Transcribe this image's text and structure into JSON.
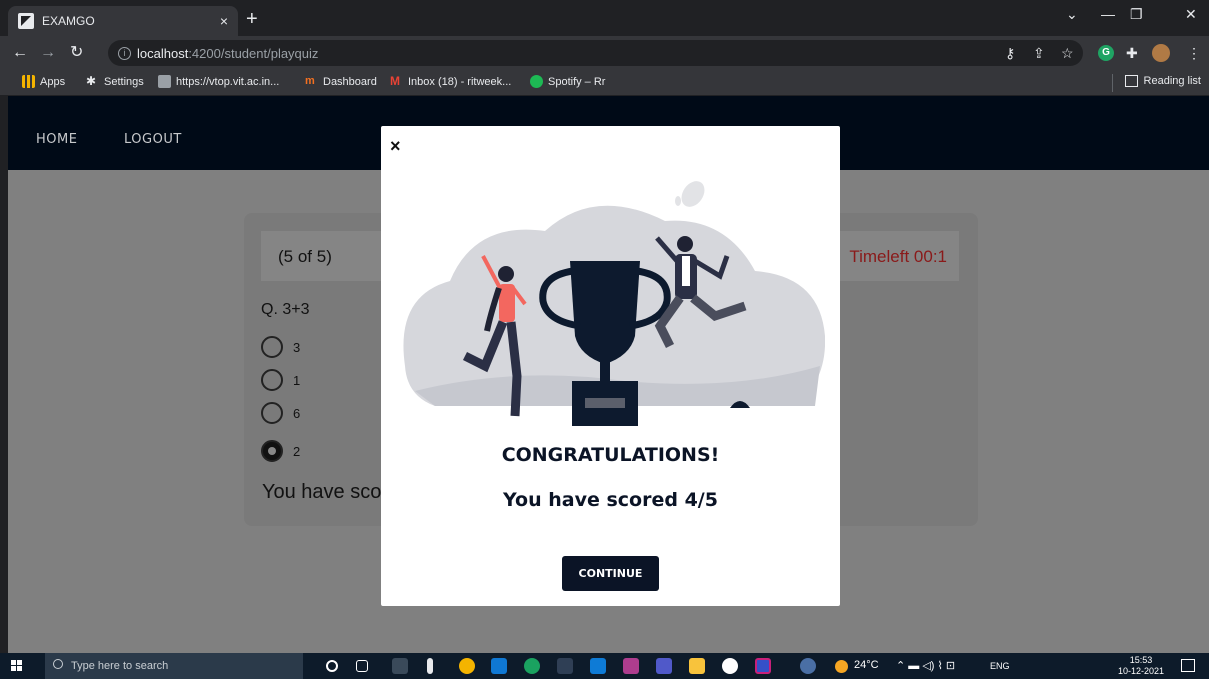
{
  "browser": {
    "tab_title": "EXAMGO",
    "tab_close": "×",
    "new_tab": "+",
    "url_host": "localhost",
    "url_path": ":4200/student/playquiz",
    "bookmarks": [
      {
        "label": "Apps",
        "icon": "apps-grid-icon",
        "color": "#f4b400"
      },
      {
        "label": "Settings",
        "icon": "gear-icon",
        "color": "#e8eaed"
      },
      {
        "label": "https://vtop.vit.ac.in...",
        "icon": "vtop-icon",
        "color": "#9aa0a6"
      },
      {
        "label": "Dashboard",
        "icon": "dashboard-icon",
        "color": "#f37021"
      },
      {
        "label": "Inbox (18) - ritweek...",
        "icon": "gmail-icon",
        "color": "#ea4335"
      },
      {
        "label": "Spotify – Rr",
        "icon": "spotify-icon",
        "color": "#1db954"
      }
    ],
    "reading_list": "Reading list",
    "g_badge": "G"
  },
  "app": {
    "nav": {
      "home": "HOME",
      "logout": "LOGOUT"
    },
    "quiz": {
      "counter": "(5 of 5)",
      "time_left": "Timeleft 00:1",
      "question": "Q. 3+3",
      "options": [
        "3",
        "1",
        "6",
        "2"
      ],
      "selected_index": 3,
      "result_text": "You have scored 4/5"
    }
  },
  "modal": {
    "close": "×",
    "title": "CONGRATULATIONS!",
    "score": "You have scored 4/5",
    "continue_label": "CONTINUE"
  },
  "taskbar": {
    "search_placeholder": "Type here to search",
    "weather": "24°C",
    "lang": "ENG",
    "time": "15:53",
    "date": "10-12-2021"
  },
  "colors": {
    "nav_bg": "#000a17",
    "button_bg": "#0b1426",
    "timer_red": "#8a1a1a"
  }
}
